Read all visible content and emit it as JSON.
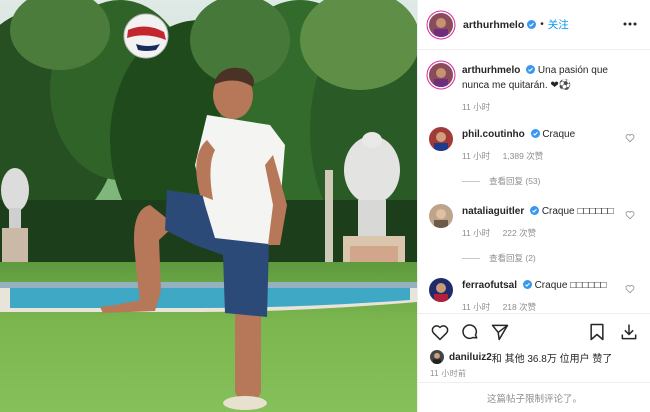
{
  "post": {
    "author": "arthurhmelo",
    "follow_label": "关注",
    "separator": "•",
    "caption": "Una pasión que nunca me quitarán. ❤⚽",
    "caption_time": "11 小时"
  },
  "comments": [
    {
      "user": "phil.coutinho",
      "text": "Craque",
      "time": "11 小时",
      "likes": "1,389 次赞",
      "replies": "查看回复 (53)"
    },
    {
      "user": "nataliaguitler",
      "text": "Craque □□□□□□",
      "time": "11 小时",
      "likes": "222 次赞",
      "replies": "查看回复 (2)"
    },
    {
      "user": "ferraofutsal",
      "text": "Craque □□□□□□",
      "time": "11 小时",
      "likes": "218 次赞"
    }
  ],
  "actions": {
    "like_icon": "heart-icon",
    "comment_icon": "comment-icon",
    "share_icon": "share-icon",
    "save_icon": "bookmark-icon",
    "download_icon": "download-icon"
  },
  "likes": {
    "user": "daniluiz2",
    "text": " 和 其他 36.8万 位用户 赞了"
  },
  "posted_time": "11 小时前",
  "comments_limited": "这篇帖子限制评论了。",
  "colors": {
    "link_blue": "#0095f6",
    "verified_blue": "#3897f0",
    "muted_gray": "#8e8e8e",
    "story_ring": "#d6249f"
  }
}
